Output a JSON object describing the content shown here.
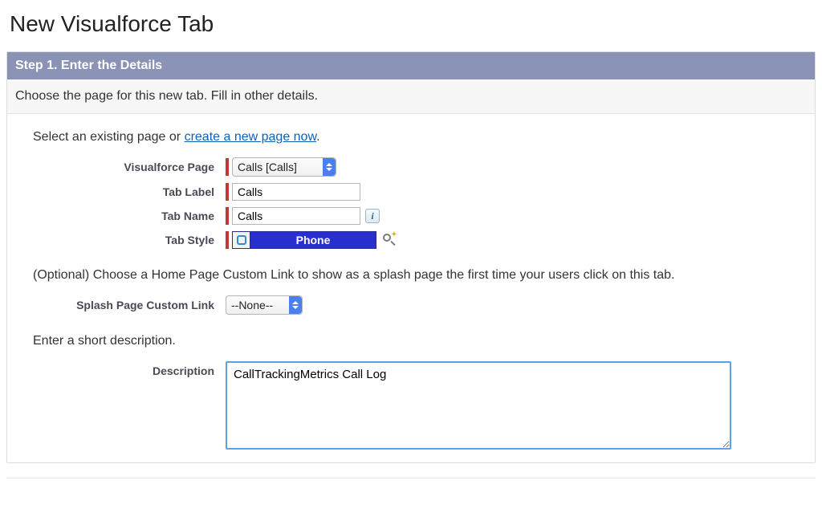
{
  "page": {
    "title": "New Visualforce Tab"
  },
  "panel": {
    "header": "Step 1. Enter the Details",
    "subheader": "Choose the page for this new tab. Fill in other details."
  },
  "section1": {
    "prompt_before_link": "Select an existing page or ",
    "prompt_link": "create a new page now",
    "prompt_after_link": "."
  },
  "fields": {
    "vf_page": {
      "label": "Visualforce Page",
      "value": "Calls [Calls]"
    },
    "tab_label": {
      "label": "Tab Label",
      "value": "Calls"
    },
    "tab_name": {
      "label": "Tab Name",
      "value": "Calls"
    },
    "tab_style": {
      "label": "Tab Style",
      "value": "Phone"
    }
  },
  "section2": {
    "prompt": "(Optional) Choose a Home Page Custom Link to show as a splash page the first time your users click on this tab.",
    "splash_link": {
      "label": "Splash Page Custom Link",
      "value": "--None--"
    }
  },
  "section3": {
    "prompt": "Enter a short description.",
    "description": {
      "label": "Description",
      "value": "CallTrackingMetrics Call Log"
    }
  }
}
